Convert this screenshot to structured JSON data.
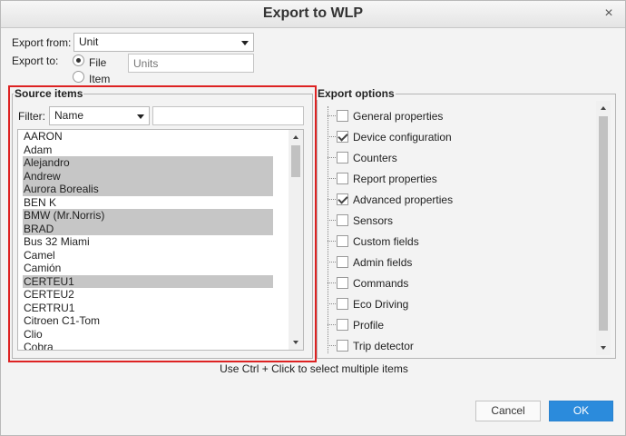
{
  "window": {
    "title": "Export to WLP",
    "close_glyph": "×"
  },
  "export_from": {
    "label": "Export from:",
    "value": "Unit"
  },
  "export_to": {
    "label": "Export to:",
    "options": [
      {
        "label": "File",
        "checked": true
      },
      {
        "label": "Item",
        "checked": false
      }
    ],
    "item_placeholder": "Units"
  },
  "source_items": {
    "legend": "Source items",
    "filter_label": "Filter:",
    "filter_value": "Name",
    "filter_text": "",
    "items": [
      {
        "label": "AARON",
        "selected": false
      },
      {
        "label": "Adam",
        "selected": false
      },
      {
        "label": "Alejandro",
        "selected": true
      },
      {
        "label": "Andrew",
        "selected": true
      },
      {
        "label": "Aurora Borealis",
        "selected": true
      },
      {
        "label": "BEN K",
        "selected": false
      },
      {
        "label": "BMW (Mr.Norris)",
        "selected": true
      },
      {
        "label": "BRAD",
        "selected": true
      },
      {
        "label": "Bus 32 Miami",
        "selected": false
      },
      {
        "label": "Camel",
        "selected": false
      },
      {
        "label": "Camión",
        "selected": false
      },
      {
        "label": "CERTEU1",
        "selected": true
      },
      {
        "label": "CERTEU2",
        "selected": false
      },
      {
        "label": "CERTRU1",
        "selected": false
      },
      {
        "label": "Citroen C1-Tom",
        "selected": false
      },
      {
        "label": "Clio",
        "selected": false
      },
      {
        "label": "Cobra",
        "selected": false
      }
    ]
  },
  "export_options": {
    "legend": "Export options",
    "items": [
      {
        "label": "General properties",
        "checked": false
      },
      {
        "label": "Device configuration",
        "checked": true
      },
      {
        "label": "Counters",
        "checked": false
      },
      {
        "label": "Report properties",
        "checked": false
      },
      {
        "label": "Advanced properties",
        "checked": true
      },
      {
        "label": "Sensors",
        "checked": false
      },
      {
        "label": "Custom fields",
        "checked": false
      },
      {
        "label": "Admin fields",
        "checked": false
      },
      {
        "label": "Commands",
        "checked": false
      },
      {
        "label": "Eco Driving",
        "checked": false
      },
      {
        "label": "Profile",
        "checked": false
      },
      {
        "label": "Trip detector",
        "checked": false
      }
    ]
  },
  "hint": "Use Ctrl + Click to select multiple items",
  "buttons": {
    "cancel": "Cancel",
    "ok": "OK"
  },
  "colors": {
    "accent": "#2b8bdc",
    "highlight_border": "#dd2222",
    "selection": "#c6c6c6"
  }
}
